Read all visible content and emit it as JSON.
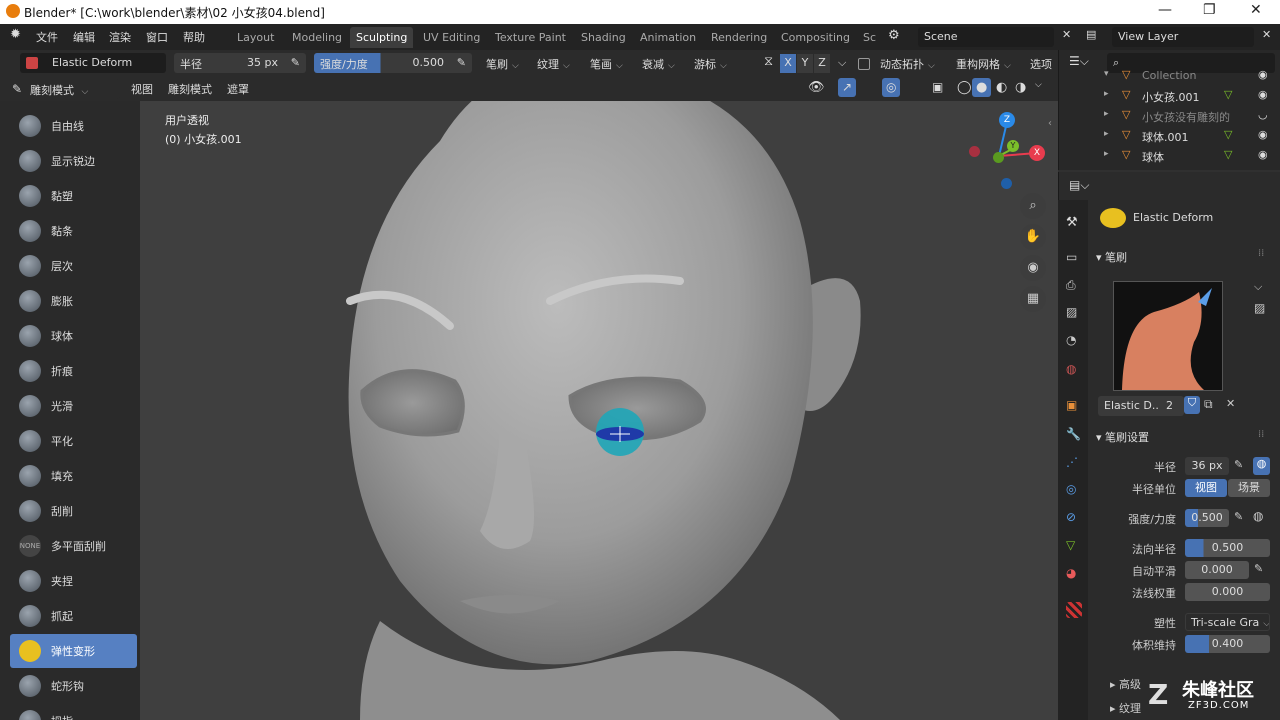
{
  "window": {
    "title": "Blender* [C:\\work\\blender\\素材\\02 小女孩04.blend]"
  },
  "menubar": {
    "items": [
      "文件",
      "编辑",
      "渲染",
      "窗口",
      "帮助"
    ],
    "workspace_tabs": [
      "Layout",
      "Modeling",
      "Sculpting",
      "UV Editing",
      "Texture Paint",
      "Shading",
      "Animation",
      "Rendering",
      "Compositing",
      "Sc"
    ],
    "active_tab": "Sculpting",
    "scene": "Scene",
    "view_layer": "View Layer"
  },
  "tool_header": {
    "brush_name": "Elastic Deform",
    "radius_label": "半径",
    "radius_value": "35 px",
    "strength_label": "强度/力度",
    "strength_value": "0.500",
    "menus": [
      "笔刷",
      "纹理",
      "笔画",
      "衰减",
      "游标"
    ],
    "axes": [
      "X",
      "Y",
      "Z"
    ],
    "dyntopo": "动态拓扑",
    "remesh": "重构网格",
    "options": "选项"
  },
  "sub_header": {
    "mode": "雕刻模式",
    "menus": [
      "视图",
      "雕刻模式",
      "遮罩"
    ]
  },
  "tools": [
    {
      "label": "自由线",
      "icon": "draw-brush-icon"
    },
    {
      "label": "显示锐边",
      "icon": "draw-sharp-icon"
    },
    {
      "label": "黏塑",
      "icon": "clay-icon"
    },
    {
      "label": "黏条",
      "icon": "clay-strips-icon"
    },
    {
      "label": "层次",
      "icon": "layer-icon"
    },
    {
      "label": "膨胀",
      "icon": "inflate-icon"
    },
    {
      "label": "球体",
      "icon": "blob-icon"
    },
    {
      "label": "折痕",
      "icon": "crease-icon"
    },
    {
      "label": "光滑",
      "icon": "smooth-icon"
    },
    {
      "label": "平化",
      "icon": "flatten-icon"
    },
    {
      "label": "填充",
      "icon": "fill-icon"
    },
    {
      "label": "刮削",
      "icon": "scrape-icon"
    },
    {
      "label": "多平面刮削",
      "icon": "multiplane-scrape-icon",
      "badge": "NONE"
    },
    {
      "label": "夹捏",
      "icon": "pinch-icon"
    },
    {
      "label": "抓起",
      "icon": "grab-icon"
    },
    {
      "label": "弹性变形",
      "icon": "elastic-deform-icon",
      "active": true
    },
    {
      "label": "蛇形钩",
      "icon": "snake-hook-icon"
    },
    {
      "label": "拇指",
      "icon": "thumb-icon"
    }
  ],
  "viewport": {
    "view_name": "用户透视",
    "object_name": "(0) 小女孩.001"
  },
  "outliner": {
    "items": [
      {
        "label": "Collection",
        "dim": true
      },
      {
        "label": "小女孩.001",
        "dim": false
      },
      {
        "label": "小女孩没有雕刻的",
        "dim": true
      },
      {
        "label": "球体.001",
        "dim": false
      },
      {
        "label": "球体",
        "dim": false
      }
    ]
  },
  "properties": {
    "brush_name": "Elastic Deform",
    "brush_panel": "笔刷",
    "brush_datablock": "Elastic D..",
    "brush_users": "2",
    "settings_panel": "笔刷设置",
    "rows": [
      {
        "label": "半径",
        "value": "36 px"
      },
      {
        "label": "半径单位",
        "value": "视图",
        "alt": "场景"
      },
      {
        "label": "强度/力度",
        "value": "0.500"
      },
      {
        "label": "法向半径",
        "value": "0.500"
      },
      {
        "label": "自动平滑",
        "value": "0.000"
      },
      {
        "label": "法线权重",
        "value": "0.000"
      },
      {
        "label": "塑性",
        "value": "Tri-scale Gra"
      },
      {
        "label": "体积维持",
        "value": "0.400"
      }
    ],
    "advanced": "高级",
    "texture": "纹理"
  },
  "watermark": {
    "text": "朱峰社区",
    "sub": "ZF3D.COM"
  },
  "colors": {
    "accent": "#5680c2",
    "axis_x": "#e83c4e",
    "axis_y": "#7bbf2a",
    "axis_z": "#2a8ae8"
  }
}
